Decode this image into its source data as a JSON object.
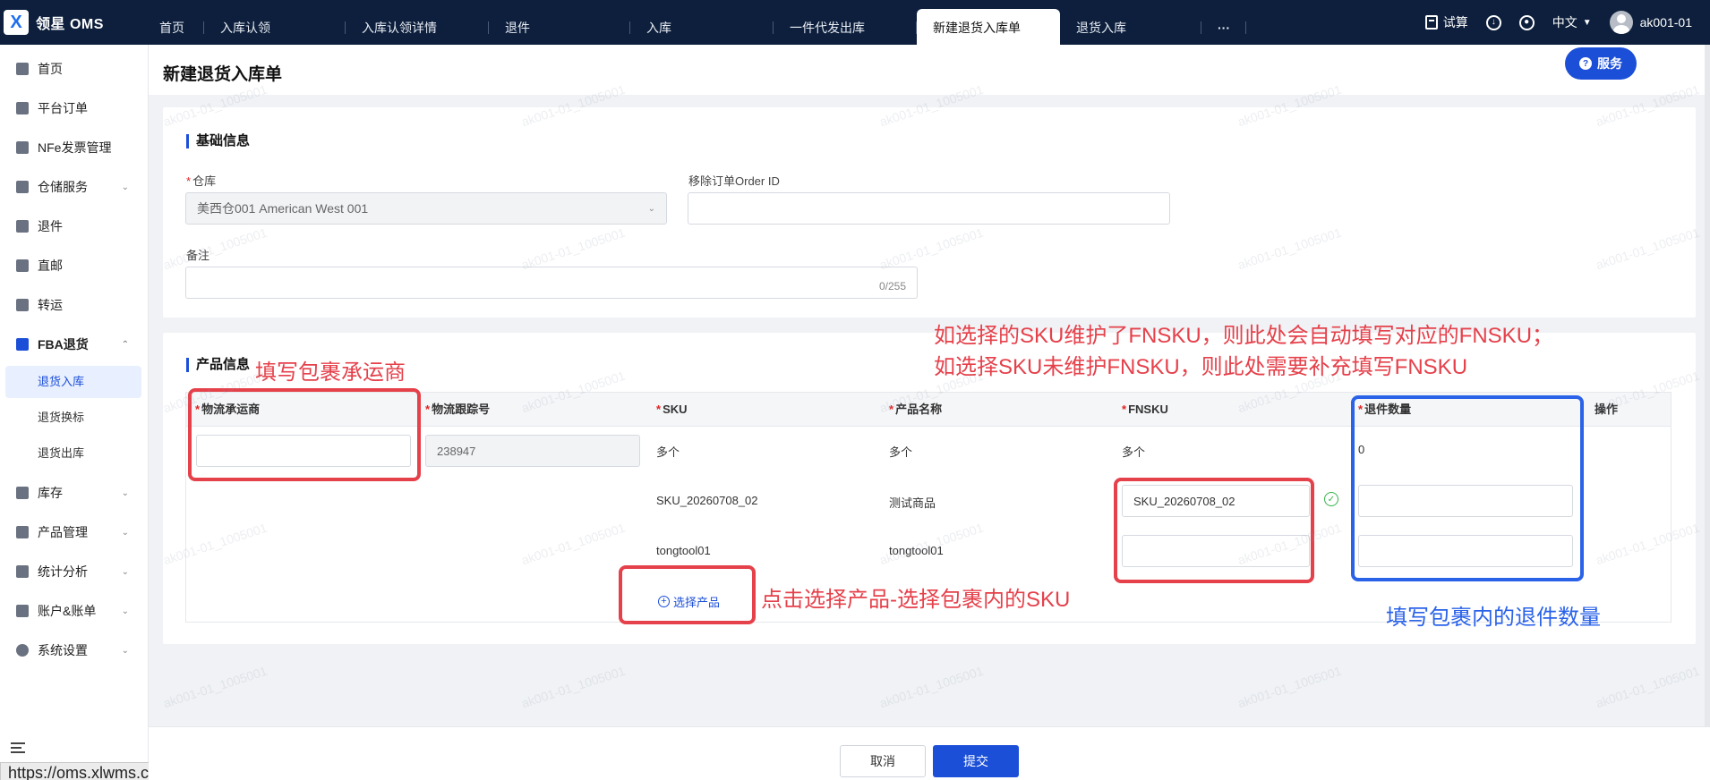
{
  "app": {
    "logo_mark": "X",
    "name": "领星 OMS"
  },
  "tabs": [
    {
      "label": "首页"
    },
    {
      "label": "入库认领"
    },
    {
      "label": "入库认领详情"
    },
    {
      "label": "退件"
    },
    {
      "label": "入库"
    },
    {
      "label": "一件代发出库"
    },
    {
      "label": "新建退货入库单",
      "active": true
    },
    {
      "label": "退货入库"
    },
    {
      "label": "···"
    }
  ],
  "topbar": {
    "calculator": "试算",
    "language": "中文",
    "user": "ak001-01"
  },
  "sidebar": {
    "items": [
      {
        "label": "首页",
        "icon": "home-icon"
      },
      {
        "label": "平台订单",
        "icon": "order-icon"
      },
      {
        "label": "NFe发票管理",
        "icon": "invoice-icon"
      },
      {
        "label": "仓储服务",
        "icon": "warehouse-service-icon",
        "chevron": "⌄"
      },
      {
        "label": "退件",
        "icon": "return-icon"
      },
      {
        "label": "直邮",
        "icon": "direct-mail-icon"
      },
      {
        "label": "转运",
        "icon": "transfer-icon"
      },
      {
        "label": "FBA退货",
        "icon": "amazon-icon",
        "chevron": "⌃"
      },
      {
        "label": "库存",
        "icon": "inventory-icon",
        "chevron": "⌄"
      },
      {
        "label": "产品管理",
        "icon": "product-icon",
        "chevron": "⌄"
      },
      {
        "label": "统计分析",
        "icon": "stats-icon",
        "chevron": "⌄"
      },
      {
        "label": "账户&账单",
        "icon": "account-icon",
        "chevron": "⌄"
      },
      {
        "label": "系统设置",
        "icon": "settings-icon",
        "chevron": "⌄"
      }
    ],
    "subitems": [
      {
        "label": "退货入库",
        "active": true
      },
      {
        "label": "退货换标"
      },
      {
        "label": "退货出库"
      }
    ],
    "status_url": "https://oms.xlwms.com"
  },
  "page": {
    "title": "新建退货入库单",
    "service_button": "服务"
  },
  "basic": {
    "section_title": "基础信息",
    "warehouse_label": "仓库",
    "warehouse_value": "美西仓001 American West 001",
    "order_id_label": "移除订单Order ID",
    "order_id_value": "",
    "remark_label": "备注",
    "remark_counter": "0/255"
  },
  "product": {
    "section_title": "产品信息",
    "columns": {
      "carrier": "物流承运商",
      "tracking": "物流跟踪号",
      "sku": "SKU",
      "name": "产品名称",
      "fnsku": "FNSKU",
      "qty": "退件数量",
      "action": "操作"
    },
    "tracking_value": "238947",
    "summary": {
      "sku": "多个",
      "name": "多个",
      "fnsku": "多个",
      "qty": "0"
    },
    "rows": [
      {
        "sku": "SKU_20260708_02",
        "name": "测试商品",
        "fnsku": "SKU_20260708_02",
        "qty": ""
      },
      {
        "sku": "tongtool01",
        "name": "tongtool01",
        "fnsku": "",
        "qty": ""
      }
    ],
    "add_product": "选择产品"
  },
  "annotations": {
    "carrier_note": "填写包裹承运商",
    "fnsku_note_line1": "如选择的SKU维护了FNSKU，则此处会自动填写对应的FNSKU；",
    "fnsku_note_line2": "如选择SKU未维护FNSKU，则此处需要补充填写FNSKU",
    "add_note": "点击选择产品-选择包裹内的SKU",
    "qty_note": "填写包裹内的退件数量",
    "red_color": "#e5414b",
    "blue_color": "#2a62e8"
  },
  "footer": {
    "cancel": "取消",
    "submit": "提交"
  },
  "watermark": "ak001-01_1005001"
}
